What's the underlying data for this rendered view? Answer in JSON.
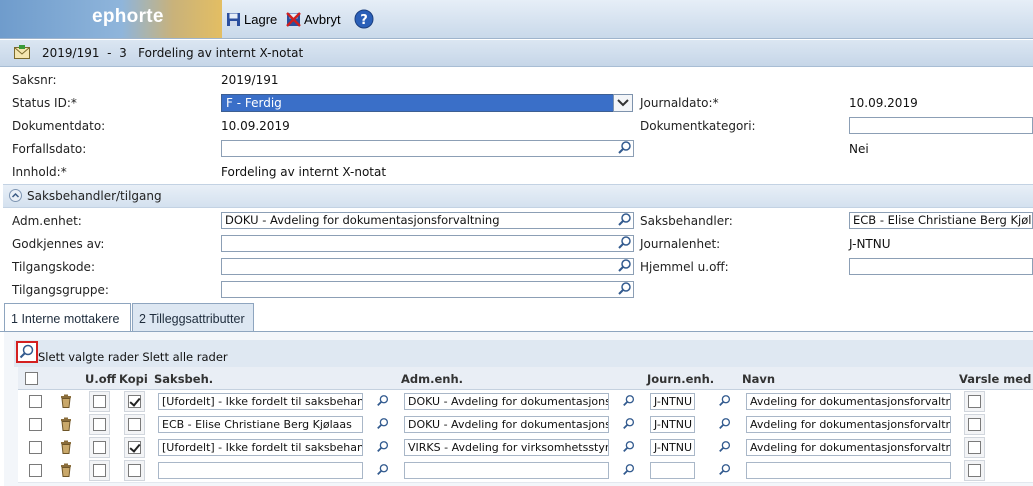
{
  "app": {
    "logo": "ephorte"
  },
  "toolbar": {
    "save_label": "Lagre",
    "cancel_label": "Avbryt"
  },
  "title": {
    "text": "2019/191  -  3   Fordeling av internt X-notat"
  },
  "form": {
    "saksnr_label": "Saksnr:",
    "saksnr_value": "2019/191",
    "status_label": "Status ID:*",
    "status_value": "F - Ferdig",
    "journaldato_label": "Journaldato:*",
    "journaldato_value": "10.09.2019",
    "dokumentdato_label": "Dokumentdato:",
    "dokumentdato_value": "10.09.2019",
    "dokumentkategori_label": "Dokumentkategori:",
    "dokumentkategori_value": "",
    "forfallsdato_label": "Forfallsdato:",
    "forfallsdato_value": "",
    "nei_value": "Nei",
    "innhold_label": "Innhold:*",
    "innhold_value": "Fordeling av internt X-notat"
  },
  "section": {
    "title": "Saksbehandler/tilgang",
    "adm_label": "Adm.enhet:",
    "adm_value": "DOKU - Avdeling for dokumentasjonsforvaltning",
    "saksbehandler_label": "Saksbehandler:",
    "saksbehandler_value": "ECB - Elise Christiane Berg Kjølaas",
    "godkjennes_label": "Godkjennes av:",
    "godkjennes_value": "",
    "journalenhet_label": "Journalenhet:",
    "journalenhet_value": "J-NTNU",
    "tilgangskode_label": "Tilgangskode:",
    "tilgangskode_value": "",
    "hjemmel_label": "Hjemmel u.off:",
    "hjemmel_value": "",
    "tilgangsgruppe_label": "Tilgangsgruppe:",
    "tilgangsgruppe_value": ""
  },
  "tabs": [
    {
      "num": "1",
      "label": "Interne mottakere"
    },
    {
      "num": "2",
      "label": "Tilleggsattributter"
    }
  ],
  "grid": {
    "actions": "Slett valgte rader Slett alle rader",
    "headers": {
      "uoff": "U.off",
      "kopi": "Kopi",
      "saksbeh": "Saksbeh.",
      "adm": "Adm.enh.",
      "journ": "Journ.enh.",
      "navn": "Navn",
      "varsle": "Varsle med E"
    },
    "rows": [
      {
        "uoff": false,
        "kopi": true,
        "saksbeh": "[Ufordelt] - Ikke fordelt til saksbehandler",
        "adm": "DOKU - Avdeling for dokumentasjonsforvaltning",
        "journ": "J-NTNU",
        "navn": "Avdeling for dokumentasjonsforvaltning"
      },
      {
        "uoff": false,
        "kopi": false,
        "saksbeh": "ECB - Elise Christiane Berg Kjølaas",
        "adm": "DOKU - Avdeling for dokumentasjonsforvaltning",
        "journ": "J-NTNU",
        "navn": "Avdeling for dokumentasjonsforvaltning"
      },
      {
        "uoff": false,
        "kopi": true,
        "saksbeh": "[Ufordelt] - Ikke fordelt til saksbehandler",
        "adm": "VIRKS - Avdeling for virksomhetsstyring",
        "journ": "J-NTNU",
        "navn": "Avdeling for dokumentasjonsforvaltning"
      },
      {
        "uoff": false,
        "kopi": false,
        "saksbeh": "",
        "adm": "",
        "journ": "",
        "navn": ""
      }
    ]
  }
}
